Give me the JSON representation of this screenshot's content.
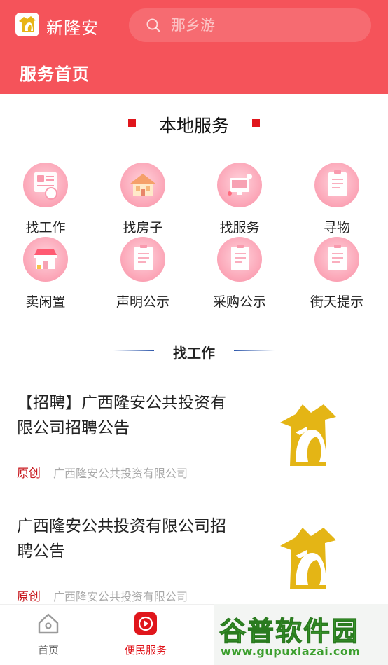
{
  "header": {
    "app_name": "新隆安",
    "search_placeholder": "那乡游",
    "page_title": "服务首页",
    "bg_color": "#f5535a"
  },
  "local_services": {
    "title": "本地服务",
    "items": [
      {
        "label": "找工作",
        "icon": "job-icon"
      },
      {
        "label": "找房子",
        "icon": "house-icon"
      },
      {
        "label": "找服务",
        "icon": "service-icon"
      },
      {
        "label": "寻物",
        "icon": "document-icon"
      },
      {
        "label": "卖闲置",
        "icon": "shop-icon"
      },
      {
        "label": "声明公示",
        "icon": "document-icon"
      },
      {
        "label": "采购公示",
        "icon": "document-icon"
      },
      {
        "label": "街天提示",
        "icon": "document-icon"
      }
    ]
  },
  "job_section": {
    "title": "找工作",
    "articles": [
      {
        "title": "【招聘】广西隆安公共投资有限公司招聘公告",
        "tag": "原创",
        "source": "广西隆安公共投资有限公司"
      },
      {
        "title": "广西隆安公共投资有限公司招聘公告",
        "tag": "原创",
        "source": "广西隆安公共投资有限公司"
      }
    ]
  },
  "tabbar": {
    "tabs": [
      {
        "label": "首页",
        "icon": "home-icon",
        "active": false
      },
      {
        "label": "便民服务",
        "icon": "play-icon",
        "active": true
      }
    ],
    "active_color": "#e0161c"
  },
  "watermark": {
    "name": "谷普软件园",
    "url": "www.gupuxlazai.com"
  }
}
